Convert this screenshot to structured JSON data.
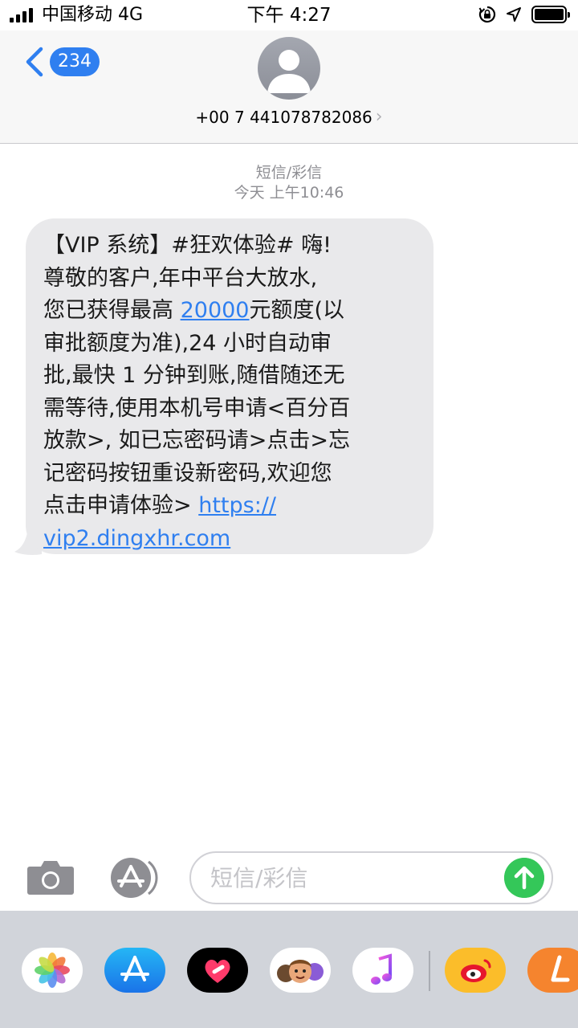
{
  "status_bar": {
    "carrier": "中国移动  4G",
    "time": "下午 4:27",
    "battery_level": 1.0,
    "signal_icon": "cellular-signal-icon",
    "lock_icon": "orientation-lock-icon",
    "location_icon": "location-arrow-icon"
  },
  "header": {
    "back_badge": "234",
    "contact_number": "+00 7 441078782086",
    "avatar_icon": "person-silhouette-icon",
    "accent": "#2f7ff0"
  },
  "thread": {
    "message_type": "短信/彩信",
    "timestamp": "今天 上午10:46"
  },
  "message": {
    "line_1": "【VIP 系统】#狂欢体验# 嗨!",
    "line_2": "尊敬的客户,年中平台大放水,",
    "line_3_before": "您已获得最高 ",
    "link_amount": "20000",
    "line_3_after": "元额度(以",
    "middle_text": "审批额度为准),24 小时自动审\n批,最快 1 分钟到账,随借随还无\n需等待,使用本机号申请<百分百\n放款>, 如已忘密码请>点击>忘\n记密码按钮重设新密码,欢迎您",
    "last_before": "点击申请体验> ",
    "link_part_1": "https://",
    "link_part_2": "vip2.dingxhr.com"
  },
  "compose": {
    "placeholder": "短信/彩信",
    "camera_icon": "camera-icon",
    "appstore_icon": "app-store-icon",
    "send_icon": "arrow-up-icon",
    "send_color": "#34c759"
  },
  "app_drawer": {
    "apps": [
      {
        "name": "photos-app-icon"
      },
      {
        "name": "app-store-app-icon"
      },
      {
        "name": "digital-touch-app-icon"
      },
      {
        "name": "memoji-app-icon"
      },
      {
        "name": "music-app-icon"
      },
      {
        "name": "weibo-app-icon"
      },
      {
        "name": "orange-l-app-icon"
      }
    ]
  }
}
